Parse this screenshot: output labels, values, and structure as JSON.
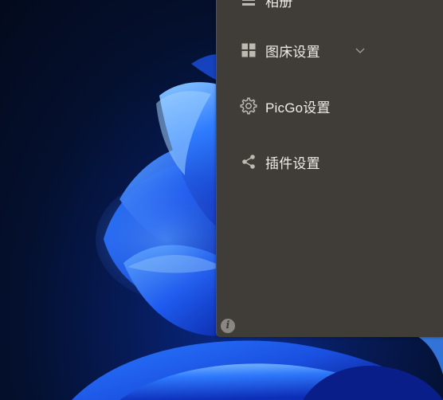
{
  "menu": {
    "items": [
      {
        "label": "相册",
        "icon": "list-icon"
      },
      {
        "label": "图床设置",
        "icon": "grid-icon",
        "expandable": true
      },
      {
        "label": "PicGo设置",
        "icon": "gear-icon"
      },
      {
        "label": "插件设置",
        "icon": "share-icon"
      }
    ]
  },
  "footer": {
    "info_glyph": "i"
  },
  "colors": {
    "panel_bg": "#403c37",
    "text": "#f0ede8",
    "icon": "#bdb9b3"
  }
}
